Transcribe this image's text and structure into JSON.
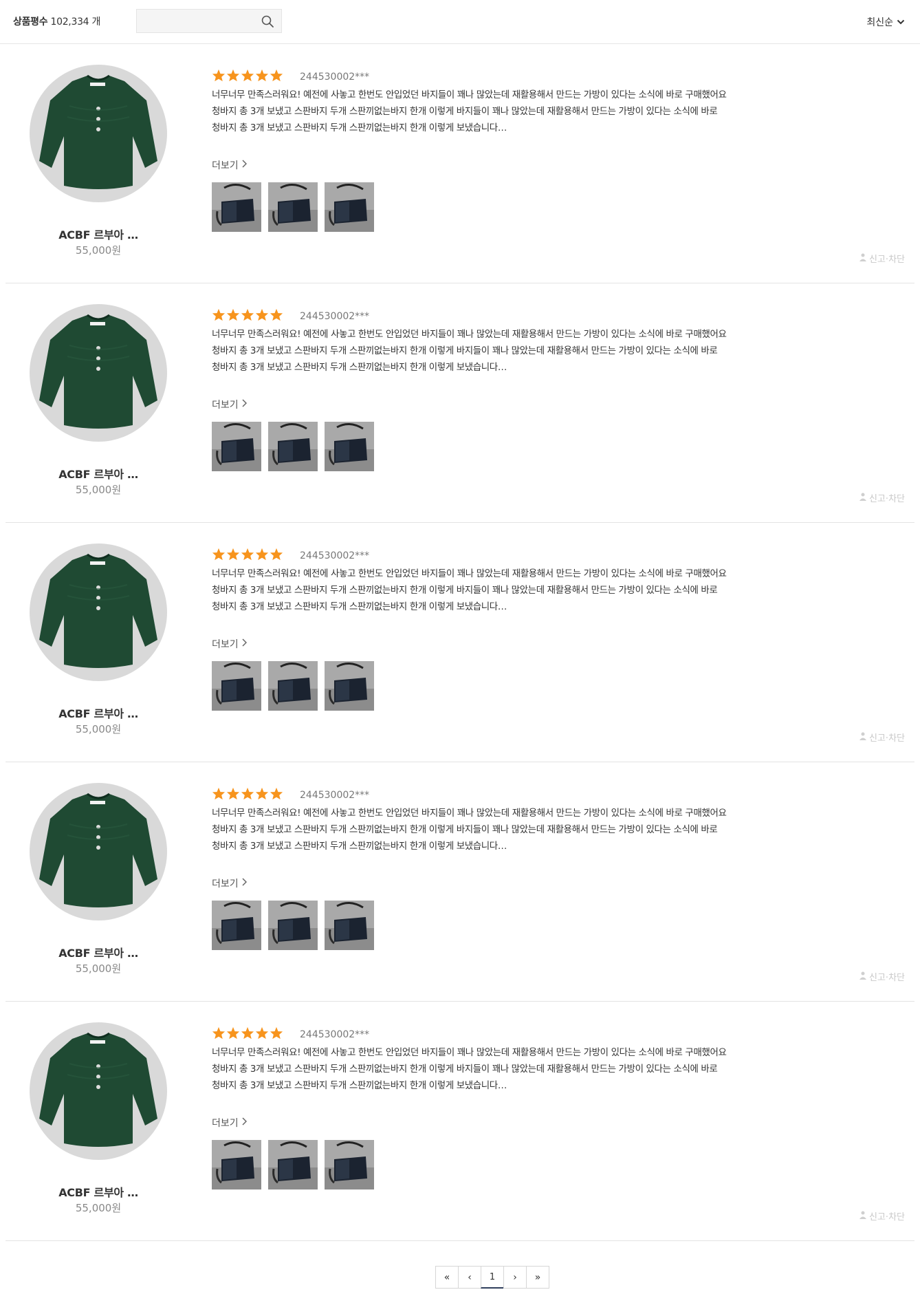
{
  "header": {
    "count_label": "상품평수",
    "count_value": "102,334",
    "count_unit": "개",
    "search_placeholder": "",
    "search_icon": "search-icon",
    "sort_label": "최신순",
    "sort_icon": "chevron-down-icon"
  },
  "colors": {
    "star": "#f7941d",
    "sweater": "#1f4a33",
    "pager_active": "#2f3e5c"
  },
  "reviews": [
    {
      "product_name": "ACBF 르부아 …",
      "price": "55,000원",
      "rating": 5,
      "user": "244530002***",
      "lines": [
        "너무너무 만족스러워요! 예전에 사놓고 한번도 안입었던 바지들이 꽤나 많았는데 재활용해서 만드는 가방이 있다는 소식에 바로 구매했어요",
        "청바지 총 3개 보냈고 스판바지 두개 스판끼없는바지 한개 이렇게 바지들이 꽤나 많았는데 재활용해서 만드는 가방이 있다는 소식에 바로",
        "청바지 총 3개 보냈고 스판바지 두개 스판끼없는바지 한개 이렇게 보냈습니다…"
      ],
      "more_label": "더보기",
      "photo_count": 3,
      "report_label": "신고·차단"
    },
    {
      "product_name": "ACBF 르부아 …",
      "price": "55,000원",
      "rating": 5,
      "user": "244530002***",
      "lines": [
        "너무너무 만족스러워요! 예전에 사놓고 한번도 안입었던 바지들이 꽤나 많았는데 재활용해서 만드는 가방이 있다는 소식에 바로 구매했어요",
        "청바지 총 3개 보냈고 스판바지 두개 스판끼없는바지 한개 이렇게 바지들이 꽤나 많았는데 재활용해서 만드는 가방이 있다는 소식에 바로",
        "청바지 총 3개 보냈고 스판바지 두개 스판끼없는바지 한개 이렇게 보냈습니다…"
      ],
      "more_label": "더보기",
      "photo_count": 3,
      "report_label": "신고·차단"
    },
    {
      "product_name": "ACBF 르부아 …",
      "price": "55,000원",
      "rating": 5,
      "user": "244530002***",
      "lines": [
        "너무너무 만족스러워요! 예전에 사놓고 한번도 안입었던 바지들이 꽤나 많았는데 재활용해서 만드는 가방이 있다는 소식에 바로 구매했어요",
        "청바지 총 3개 보냈고 스판바지 두개 스판끼없는바지 한개 이렇게 바지들이 꽤나 많았는데 재활용해서 만드는 가방이 있다는 소식에 바로",
        "청바지 총 3개 보냈고 스판바지 두개 스판끼없는바지 한개 이렇게 보냈습니다…"
      ],
      "more_label": "더보기",
      "photo_count": 3,
      "report_label": "신고·차단"
    },
    {
      "product_name": "ACBF 르부아 …",
      "price": "55,000원",
      "rating": 5,
      "user": "244530002***",
      "lines": [
        "너무너무 만족스러워요! 예전에 사놓고 한번도 안입었던 바지들이 꽤나 많았는데 재활용해서 만드는 가방이 있다는 소식에 바로 구매했어요",
        "청바지 총 3개 보냈고 스판바지 두개 스판끼없는바지 한개 이렇게 바지들이 꽤나 많았는데 재활용해서 만드는 가방이 있다는 소식에 바로",
        "청바지 총 3개 보냈고 스판바지 두개 스판끼없는바지 한개 이렇게 보냈습니다…"
      ],
      "more_label": "더보기",
      "photo_count": 3,
      "report_label": "신고·차단"
    },
    {
      "product_name": "ACBF 르부아 …",
      "price": "55,000원",
      "rating": 5,
      "user": "244530002***",
      "lines": [
        "너무너무 만족스러워요! 예전에 사놓고 한번도 안입었던 바지들이 꽤나 많았는데 재활용해서 만드는 가방이 있다는 소식에 바로 구매했어요",
        "청바지 총 3개 보냈고 스판바지 두개 스판끼없는바지 한개 이렇게 바지들이 꽤나 많았는데 재활용해서 만드는 가방이 있다는 소식에 바로",
        "청바지 총 3개 보냈고 스판바지 두개 스판끼없는바지 한개 이렇게 보냈습니다…"
      ],
      "more_label": "더보기",
      "photo_count": 3,
      "report_label": "신고·차단"
    }
  ],
  "pagination": {
    "first": "«",
    "prev": "‹",
    "current": "1",
    "next": "›",
    "last": "»"
  }
}
